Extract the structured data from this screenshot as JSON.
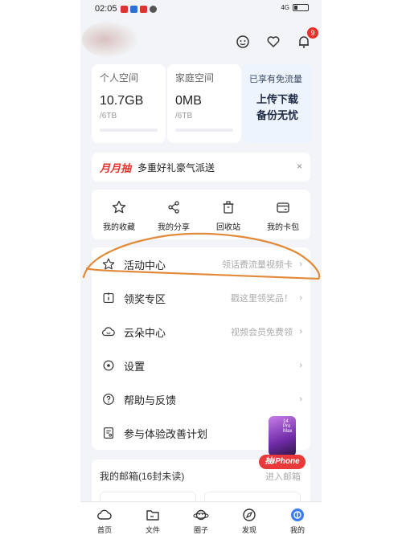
{
  "status": {
    "time": "02:05",
    "network": "4G"
  },
  "header": {
    "notification_count": "9"
  },
  "storage": [
    {
      "title": "个人空间",
      "value": "10.7GB",
      "total": "/6TB"
    },
    {
      "title": "家庭空间",
      "value": "0MB",
      "total": "/6TB"
    }
  ],
  "promo": {
    "head": "已享有免流量",
    "line1": "上传下载",
    "line2": "备份无忧"
  },
  "banner": {
    "logo": "月月抽",
    "text": "多重好礼豪气派送",
    "close": "×"
  },
  "quick": [
    {
      "label": "我的收藏",
      "icon": "star-icon"
    },
    {
      "label": "我的分享",
      "icon": "share-icon"
    },
    {
      "label": "回收站",
      "icon": "trash-icon"
    },
    {
      "label": "我的卡包",
      "icon": "wallet-icon"
    }
  ],
  "list": [
    {
      "label": "活动中心",
      "hint": "领话费流量视频卡",
      "icon": "star-outline-icon"
    },
    {
      "label": "领奖专区",
      "hint": "戳这里领奖品！",
      "icon": "gift-box-icon"
    },
    {
      "label": "云朵中心",
      "hint": "视频会员免费领",
      "icon": "cloud-icon"
    },
    {
      "label": "设置",
      "hint": "",
      "icon": "settings-icon"
    },
    {
      "label": "帮助与反馈",
      "hint": "",
      "icon": "help-icon"
    },
    {
      "label": "参与体验改善计划",
      "hint": "",
      "icon": "survey-icon"
    }
  ],
  "mail": {
    "title": "我的邮箱(16封未读)",
    "link": "进入邮箱"
  },
  "float_promo": {
    "label": "抽iPhone",
    "small": "14 Pro Max"
  },
  "nav": [
    {
      "label": "首页",
      "icon": "home-cloud-icon"
    },
    {
      "label": "文件",
      "icon": "folder-icon"
    },
    {
      "label": "圈子",
      "icon": "planet-icon"
    },
    {
      "label": "发现",
      "icon": "compass-icon"
    },
    {
      "label": "我的",
      "icon": "profile-icon"
    }
  ],
  "colors": {
    "accent": "#e5322d",
    "scribble": "#e08a3a",
    "background": "#f2f4f7"
  }
}
